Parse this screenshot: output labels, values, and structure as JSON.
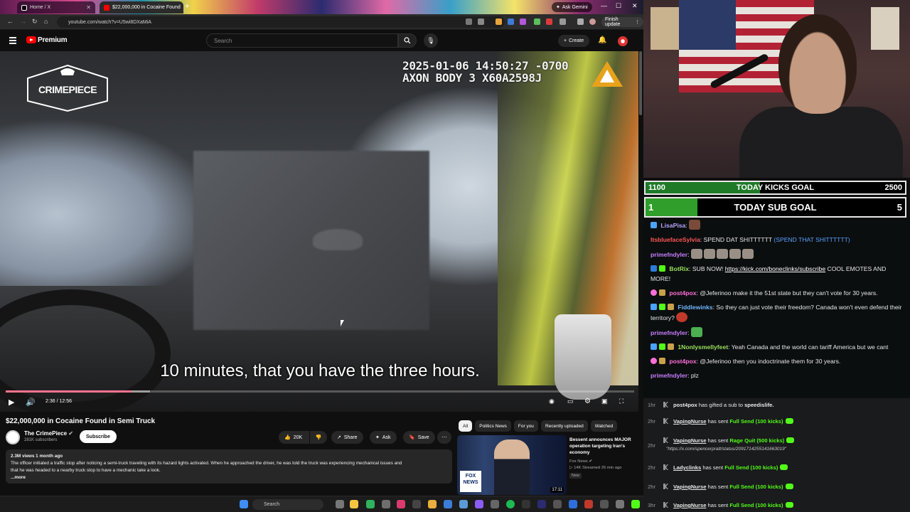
{
  "browser": {
    "tabs": [
      {
        "label": "Home / X",
        "active": false
      },
      {
        "label": "$22,000,000 in Cocaine Found",
        "active": true
      }
    ],
    "url": "youtube.com/watch?v=U5wi8DXaMiA",
    "ask_gemini": "Ask Gemini",
    "finish_update": "Finish update"
  },
  "youtube": {
    "brand": "Premium",
    "search_placeholder": "Search",
    "create_label": "Create"
  },
  "video": {
    "timestamp_line1": "2025-01-06 14:50:27 -0700",
    "timestamp_line2": "AXON BODY 3 X60A2598J",
    "watermark": "CRIMEPIECE",
    "caption": "10 minutes, that you have the three hours.",
    "time_display": "2:36 / 12:56",
    "progress_fraction": 0.2
  },
  "details": {
    "title": "$22,000,000 in Cocaine Found in Semi Truck",
    "channel": "The CrimePiece",
    "subscribers": "281K subscribers",
    "subscribe_label": "Subscribe",
    "likes": "20K",
    "share_label": "Share",
    "ask_label": "Ask",
    "save_label": "Save",
    "views_date": "2.3M views  1 month ago",
    "description_line1": "The officer initiated a traffic stop after noticing a semi-truck traveling with its hazard lights activated. When he approached the driver, he was told the truck was experiencing mechanical issues and",
    "description_line2": "that he was headed to a nearby truck stop to have a mechanic take a look.",
    "more_label": "...more"
  },
  "recommendations": {
    "chips": [
      "All",
      "Politics News",
      "For you",
      "Recently uploaded",
      "Watched"
    ],
    "item": {
      "title": "Bessent announces MAJOR operation targeting Iran's economy",
      "channel": "Fox News",
      "stats": "14K  Streamed 26 min ago",
      "badge": "New",
      "duration": "17:11",
      "thumb_logo": "FOX NEWS"
    }
  },
  "taskbar": {
    "search_label": "Search"
  },
  "goals": {
    "kicks": {
      "label": "TODAY KICKS GOAL",
      "current": "1100",
      "target": "2500",
      "fraction": 0.44
    },
    "subs": {
      "label": "TODAY SUB GOAL",
      "current": "1",
      "target": "5",
      "fraction": 0.2
    }
  },
  "chat": [
    {
      "user": "LisaPisa",
      "color": "#b7a6ff",
      "text": ""
    },
    {
      "user": "ItsbluefaceSylvia",
      "color": "#ff5555",
      "text": "SPEND DAT SHITTTTTT",
      "extra": "(SPEND THAT SHITTTTTT)"
    },
    {
      "user": "primefndyler",
      "color": "#c77dff",
      "text": ""
    },
    {
      "user": "BotRix",
      "color": "#9be15d",
      "text": "SUB NOW!",
      "link": "https://kick.com/boneclinks/subscribe",
      "after": "COOL EMOTES AND MORE!"
    },
    {
      "user": "post4pox",
      "color": "#ff6fd8",
      "text": "@Jeferinoo make it the 51st state but they can't vote for 30 years."
    },
    {
      "user": "Fiddlewinks",
      "color": "#6fb7ff",
      "text": "So they can just vote their freedom? Canada won't even defend their territory?"
    },
    {
      "user": "primefndyler",
      "color": "#c77dff",
      "text": ""
    },
    {
      "user": "1Nonlysmellyfeet",
      "color": "#9be15d",
      "text": "Yeah Canada and the world can tariff America but we cant"
    },
    {
      "user": "post4pox",
      "color": "#ff6fd8",
      "text": "@Jeferinoo then you indoctrinate them for 30 years."
    },
    {
      "user": "primefndyler",
      "color": "#c77dff",
      "text": "plz"
    }
  ],
  "events": [
    {
      "time": "1hr",
      "user": "post4pox",
      "action": "has gifted a sub to",
      "target": "speedislife."
    },
    {
      "time": "2hr",
      "user": "VapingNurse",
      "action": "has sent",
      "target": "Full Send (100 kicks)"
    },
    {
      "time": "2hr",
      "user": "VapingNurse",
      "action": "has sent",
      "target": "Rage Quit (500 kicks)",
      "note": "\"https://x.com/spencerpratt/status/2091714255141663019\""
    },
    {
      "time": "2hr",
      "user": "Ladyclinks",
      "action": "has sent",
      "target": "Full Send (100 kicks)"
    },
    {
      "time": "2hr",
      "user": "VapingNurse",
      "action": "has sent",
      "target": "Full Send (100 kicks)"
    },
    {
      "time": "3hr",
      "user": "VapingNurse",
      "action": "has sent",
      "target": "Full Send (100 kicks)"
    }
  ]
}
